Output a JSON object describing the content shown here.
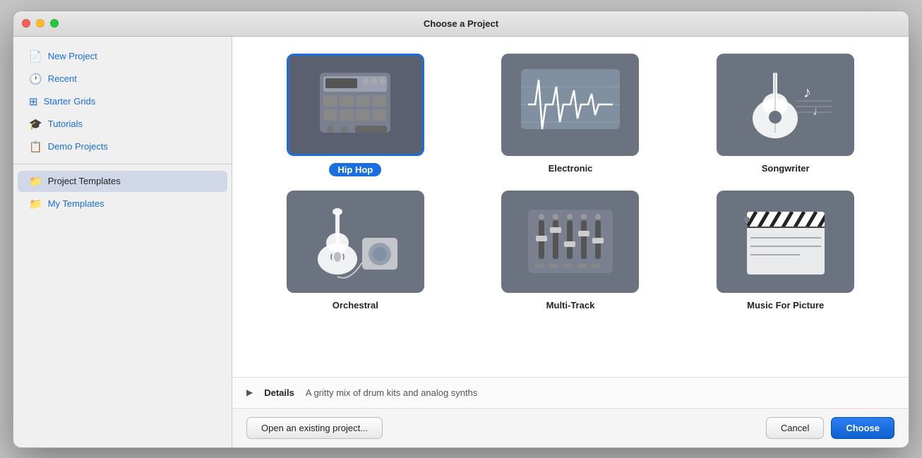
{
  "window": {
    "title": "Choose a Project"
  },
  "traffic_lights": {
    "close_label": "close",
    "minimize_label": "minimize",
    "maximize_label": "maximize"
  },
  "sidebar": {
    "items": [
      {
        "id": "new-project",
        "icon": "📄",
        "label": "New Project",
        "active": false
      },
      {
        "id": "recent",
        "icon": "🕐",
        "label": "Recent",
        "active": false
      },
      {
        "id": "starter-grids",
        "icon": "⊞",
        "label": "Starter Grids",
        "active": false
      },
      {
        "id": "tutorials",
        "icon": "🎓",
        "label": "Tutorials",
        "active": false
      },
      {
        "id": "demo-projects",
        "icon": "📋",
        "label": "Demo Projects",
        "active": false
      },
      {
        "id": "project-templates",
        "icon": "📁",
        "label": "Project Templates",
        "active": true
      },
      {
        "id": "my-templates",
        "icon": "📁",
        "label": "My Templates",
        "active": false
      }
    ]
  },
  "templates": {
    "items": [
      {
        "id": "hip-hop",
        "label": "Hip Hop",
        "selected": true,
        "badge": true
      },
      {
        "id": "electronic",
        "label": "Electronic",
        "selected": false,
        "badge": false
      },
      {
        "id": "songwriter",
        "label": "Songwriter",
        "selected": false,
        "badge": false
      },
      {
        "id": "orchestral",
        "label": "Orchestral",
        "selected": false,
        "badge": false
      },
      {
        "id": "multi-track",
        "label": "Multi-Track",
        "selected": false,
        "badge": false
      },
      {
        "id": "music-for-picture",
        "label": "Music For Picture",
        "selected": false,
        "badge": false
      }
    ]
  },
  "details": {
    "label": "Details",
    "text": "A gritty mix of drum kits and analog synths"
  },
  "bottom": {
    "open_existing_label": "Open an existing project...",
    "cancel_label": "Cancel",
    "choose_label": "Choose"
  }
}
